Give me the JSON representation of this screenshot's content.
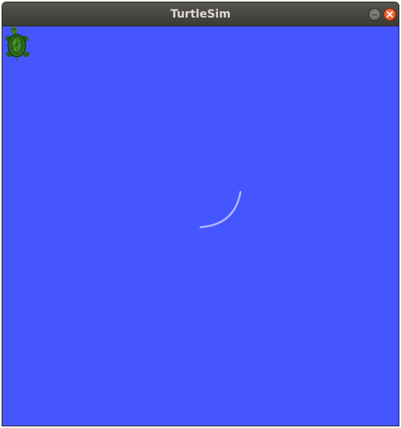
{
  "window": {
    "title": "TurtleSim"
  },
  "canvas": {
    "background_color": "#4556ff",
    "pen_color": "#b3b8ff"
  },
  "turtle": {
    "icon": "turtle-icon",
    "color": "#2f6a1e"
  },
  "titlebar": {
    "minimize_icon": "minimize-icon",
    "close_icon": "close-icon"
  }
}
